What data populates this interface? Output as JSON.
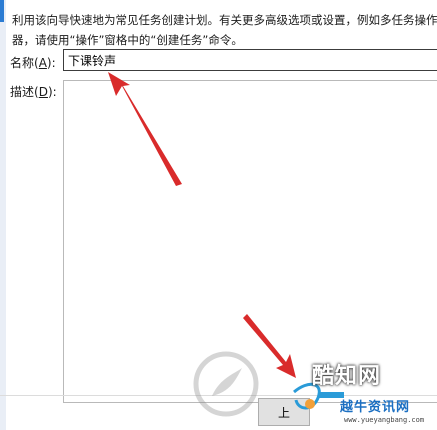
{
  "description": {
    "line1": "利用该向导快速地为常见任务创建计划。有关更多高级选项或设置，例如多任务操作",
    "line2": "器，请使用“操作”窗格中的“创建任务”命令。"
  },
  "name_field": {
    "label": "名称",
    "label_prefix": "(",
    "accelerator": "A",
    "label_suffix": "):",
    "value": "下课铃声"
  },
  "description_field": {
    "label": "描述",
    "label_prefix": "(",
    "accelerator": "D",
    "label_suffix": "):",
    "value": ""
  },
  "bottom_button": {
    "label": "上"
  },
  "watermark": {
    "brand_name": "酷知网",
    "url_cn": "越牛资讯网",
    "url": "www.yueyangbang.com"
  },
  "colors": {
    "accent": "#2b7cd3",
    "arrow": "#d92b2b"
  },
  "icons": {
    "arrow_to_name": "red-arrow-icon",
    "arrow_to_button": "red-arrow-icon",
    "watermark_logo": "swirl-logo-icon"
  }
}
